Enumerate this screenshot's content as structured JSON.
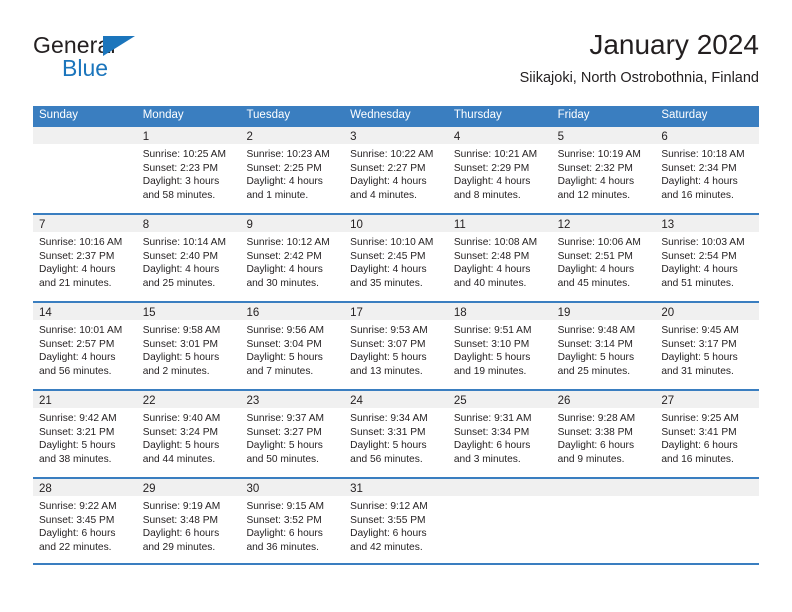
{
  "brand": {
    "name_top": "General",
    "name_bottom": "Blue",
    "accent_color": "#1b75bc"
  },
  "header": {
    "title": "January 2024",
    "subtitle": "Siikajoki, North Ostrobothnia, Finland"
  },
  "calendar": {
    "header_color": "#3a7ec0",
    "daynum_band_color": "#f0f0f0",
    "weekdays": [
      "Sunday",
      "Monday",
      "Tuesday",
      "Wednesday",
      "Thursday",
      "Friday",
      "Saturday"
    ],
    "weeks": [
      [
        {
          "day": "",
          "lines": []
        },
        {
          "day": "1",
          "lines": [
            "Sunrise: 10:25 AM",
            "Sunset: 2:23 PM",
            "Daylight: 3 hours",
            "and 58 minutes."
          ]
        },
        {
          "day": "2",
          "lines": [
            "Sunrise: 10:23 AM",
            "Sunset: 2:25 PM",
            "Daylight: 4 hours",
            "and 1 minute."
          ]
        },
        {
          "day": "3",
          "lines": [
            "Sunrise: 10:22 AM",
            "Sunset: 2:27 PM",
            "Daylight: 4 hours",
            "and 4 minutes."
          ]
        },
        {
          "day": "4",
          "lines": [
            "Sunrise: 10:21 AM",
            "Sunset: 2:29 PM",
            "Daylight: 4 hours",
            "and 8 minutes."
          ]
        },
        {
          "day": "5",
          "lines": [
            "Sunrise: 10:19 AM",
            "Sunset: 2:32 PM",
            "Daylight: 4 hours",
            "and 12 minutes."
          ]
        },
        {
          "day": "6",
          "lines": [
            "Sunrise: 10:18 AM",
            "Sunset: 2:34 PM",
            "Daylight: 4 hours",
            "and 16 minutes."
          ]
        }
      ],
      [
        {
          "day": "7",
          "lines": [
            "Sunrise: 10:16 AM",
            "Sunset: 2:37 PM",
            "Daylight: 4 hours",
            "and 21 minutes."
          ]
        },
        {
          "day": "8",
          "lines": [
            "Sunrise: 10:14 AM",
            "Sunset: 2:40 PM",
            "Daylight: 4 hours",
            "and 25 minutes."
          ]
        },
        {
          "day": "9",
          "lines": [
            "Sunrise: 10:12 AM",
            "Sunset: 2:42 PM",
            "Daylight: 4 hours",
            "and 30 minutes."
          ]
        },
        {
          "day": "10",
          "lines": [
            "Sunrise: 10:10 AM",
            "Sunset: 2:45 PM",
            "Daylight: 4 hours",
            "and 35 minutes."
          ]
        },
        {
          "day": "11",
          "lines": [
            "Sunrise: 10:08 AM",
            "Sunset: 2:48 PM",
            "Daylight: 4 hours",
            "and 40 minutes."
          ]
        },
        {
          "day": "12",
          "lines": [
            "Sunrise: 10:06 AM",
            "Sunset: 2:51 PM",
            "Daylight: 4 hours",
            "and 45 minutes."
          ]
        },
        {
          "day": "13",
          "lines": [
            "Sunrise: 10:03 AM",
            "Sunset: 2:54 PM",
            "Daylight: 4 hours",
            "and 51 minutes."
          ]
        }
      ],
      [
        {
          "day": "14",
          "lines": [
            "Sunrise: 10:01 AM",
            "Sunset: 2:57 PM",
            "Daylight: 4 hours",
            "and 56 minutes."
          ]
        },
        {
          "day": "15",
          "lines": [
            "Sunrise: 9:58 AM",
            "Sunset: 3:01 PM",
            "Daylight: 5 hours",
            "and 2 minutes."
          ]
        },
        {
          "day": "16",
          "lines": [
            "Sunrise: 9:56 AM",
            "Sunset: 3:04 PM",
            "Daylight: 5 hours",
            "and 7 minutes."
          ]
        },
        {
          "day": "17",
          "lines": [
            "Sunrise: 9:53 AM",
            "Sunset: 3:07 PM",
            "Daylight: 5 hours",
            "and 13 minutes."
          ]
        },
        {
          "day": "18",
          "lines": [
            "Sunrise: 9:51 AM",
            "Sunset: 3:10 PM",
            "Daylight: 5 hours",
            "and 19 minutes."
          ]
        },
        {
          "day": "19",
          "lines": [
            "Sunrise: 9:48 AM",
            "Sunset: 3:14 PM",
            "Daylight: 5 hours",
            "and 25 minutes."
          ]
        },
        {
          "day": "20",
          "lines": [
            "Sunrise: 9:45 AM",
            "Sunset: 3:17 PM",
            "Daylight: 5 hours",
            "and 31 minutes."
          ]
        }
      ],
      [
        {
          "day": "21",
          "lines": [
            "Sunrise: 9:42 AM",
            "Sunset: 3:21 PM",
            "Daylight: 5 hours",
            "and 38 minutes."
          ]
        },
        {
          "day": "22",
          "lines": [
            "Sunrise: 9:40 AM",
            "Sunset: 3:24 PM",
            "Daylight: 5 hours",
            "and 44 minutes."
          ]
        },
        {
          "day": "23",
          "lines": [
            "Sunrise: 9:37 AM",
            "Sunset: 3:27 PM",
            "Daylight: 5 hours",
            "and 50 minutes."
          ]
        },
        {
          "day": "24",
          "lines": [
            "Sunrise: 9:34 AM",
            "Sunset: 3:31 PM",
            "Daylight: 5 hours",
            "and 56 minutes."
          ]
        },
        {
          "day": "25",
          "lines": [
            "Sunrise: 9:31 AM",
            "Sunset: 3:34 PM",
            "Daylight: 6 hours",
            "and 3 minutes."
          ]
        },
        {
          "day": "26",
          "lines": [
            "Sunrise: 9:28 AM",
            "Sunset: 3:38 PM",
            "Daylight: 6 hours",
            "and 9 minutes."
          ]
        },
        {
          "day": "27",
          "lines": [
            "Sunrise: 9:25 AM",
            "Sunset: 3:41 PM",
            "Daylight: 6 hours",
            "and 16 minutes."
          ]
        }
      ],
      [
        {
          "day": "28",
          "lines": [
            "Sunrise: 9:22 AM",
            "Sunset: 3:45 PM",
            "Daylight: 6 hours",
            "and 22 minutes."
          ]
        },
        {
          "day": "29",
          "lines": [
            "Sunrise: 9:19 AM",
            "Sunset: 3:48 PM",
            "Daylight: 6 hours",
            "and 29 minutes."
          ]
        },
        {
          "day": "30",
          "lines": [
            "Sunrise: 9:15 AM",
            "Sunset: 3:52 PM",
            "Daylight: 6 hours",
            "and 36 minutes."
          ]
        },
        {
          "day": "31",
          "lines": [
            "Sunrise: 9:12 AM",
            "Sunset: 3:55 PM",
            "Daylight: 6 hours",
            "and 42 minutes."
          ]
        },
        {
          "day": "",
          "lines": []
        },
        {
          "day": "",
          "lines": []
        },
        {
          "day": "",
          "lines": []
        }
      ]
    ]
  }
}
